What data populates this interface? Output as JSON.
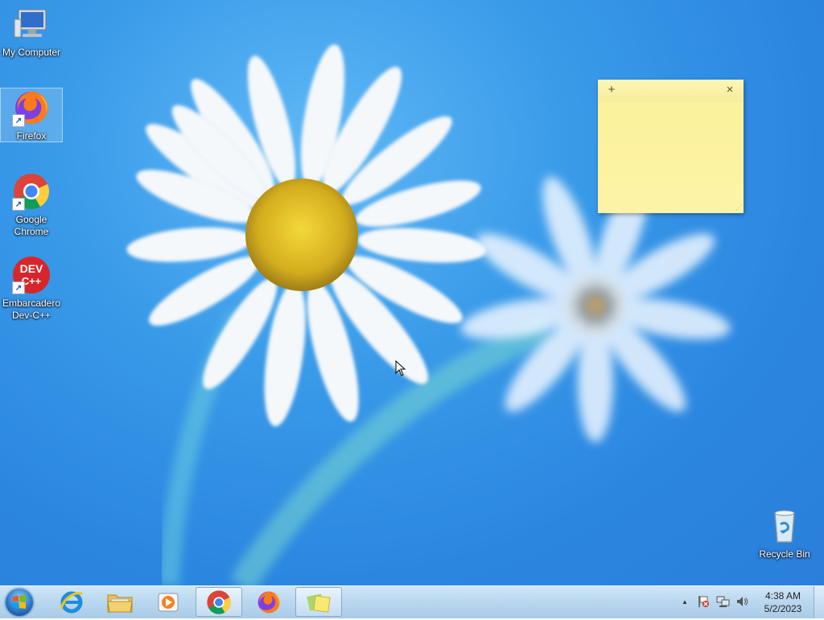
{
  "desktop": {
    "icons": [
      {
        "label": "My Computer",
        "icon": "computer-icon"
      },
      {
        "label": "Firefox",
        "icon": "firefox-icon"
      },
      {
        "label": "Google Chrome",
        "icon": "chrome-icon"
      },
      {
        "label": "Embarcadero Dev-C++",
        "icon": "devcpp-icon",
        "logo_text": "DEV C++"
      },
      {
        "label": "Recycle Bin",
        "icon": "recycle-bin-icon"
      }
    ]
  },
  "sticky_note": {
    "add_label": "+",
    "close_label": "×",
    "content": ""
  },
  "taskbar": {
    "pinned": [
      {
        "name": "internet-explorer",
        "icon": "ie-icon"
      },
      {
        "name": "file-explorer",
        "icon": "folder-icon"
      },
      {
        "name": "media-player",
        "icon": "media-player-icon"
      },
      {
        "name": "google-chrome",
        "icon": "chrome-icon",
        "active": true
      },
      {
        "name": "firefox",
        "icon": "firefox-icon"
      },
      {
        "name": "sticky-notes",
        "icon": "sticky-notes-icon",
        "active": true
      }
    ],
    "tray": {
      "show_hidden_label": "▲",
      "time": "4:38 AM",
      "date": "5/2/2023"
    }
  },
  "colors": {
    "wallpaper": "#2b86e0",
    "sticky_note": "#fcf3a6",
    "taskbar": "#b9d7ef"
  }
}
